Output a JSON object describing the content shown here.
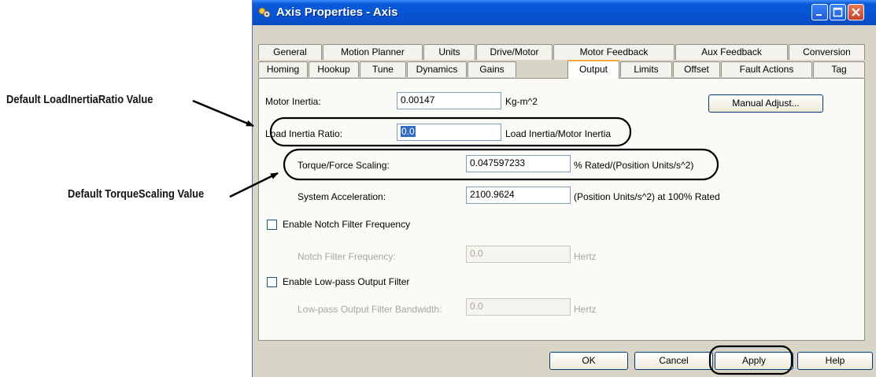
{
  "callouts": {
    "load_inertia": "Default LoadInertiaRatio Value",
    "torque_scaling": "Default TorqueScaling Value"
  },
  "window": {
    "title": "Axis Properties - Axis",
    "title_bar_color": "#0654d3"
  },
  "tabs": {
    "row1": [
      "General",
      "Motion Planner",
      "Units",
      "Drive/Motor",
      "Motor Feedback",
      "Aux Feedback",
      "Conversion"
    ],
    "row2": [
      "Homing",
      "Hookup",
      "Tune",
      "Dynamics",
      "Gains",
      "Output",
      "Limits",
      "Offset",
      "Fault Actions",
      "Tag"
    ],
    "active": "Output",
    "active_accent": "#f2a83a"
  },
  "output": {
    "motor_inertia": {
      "label": "Motor Inertia:",
      "value": "0.00147",
      "unit": "Kg-m^2"
    },
    "load_inertia_ratio": {
      "label": "Load Inertia Ratio:",
      "value": "0.0",
      "unit": "Load Inertia/Motor Inertia"
    },
    "torque_force_scaling": {
      "label": "Torque/Force Scaling:",
      "value": "0.047597233",
      "unit": "% Rated/(Position Units/s^2)"
    },
    "system_acceleration": {
      "label": "System Acceleration:",
      "value": "2100.9624",
      "unit": "(Position Units/s^2) at 100% Rated"
    },
    "enable_notch": {
      "label": "Enable Notch Filter Frequency",
      "checked": false
    },
    "notch_frequency": {
      "label": "Notch Filter Frequency:",
      "value": "0.0",
      "unit": "Hertz"
    },
    "enable_lowpass": {
      "label": "Enable Low-pass Output Filter",
      "checked": false
    },
    "lowpass_bandwidth": {
      "label": "Low-pass Output Filter Bandwidth:",
      "value": "0.0",
      "unit": "Hertz"
    },
    "manual_adjust": "Manual Adjust..."
  },
  "buttons": {
    "ok": "OK",
    "cancel": "Cancel",
    "apply": "Apply",
    "help": "Help"
  }
}
